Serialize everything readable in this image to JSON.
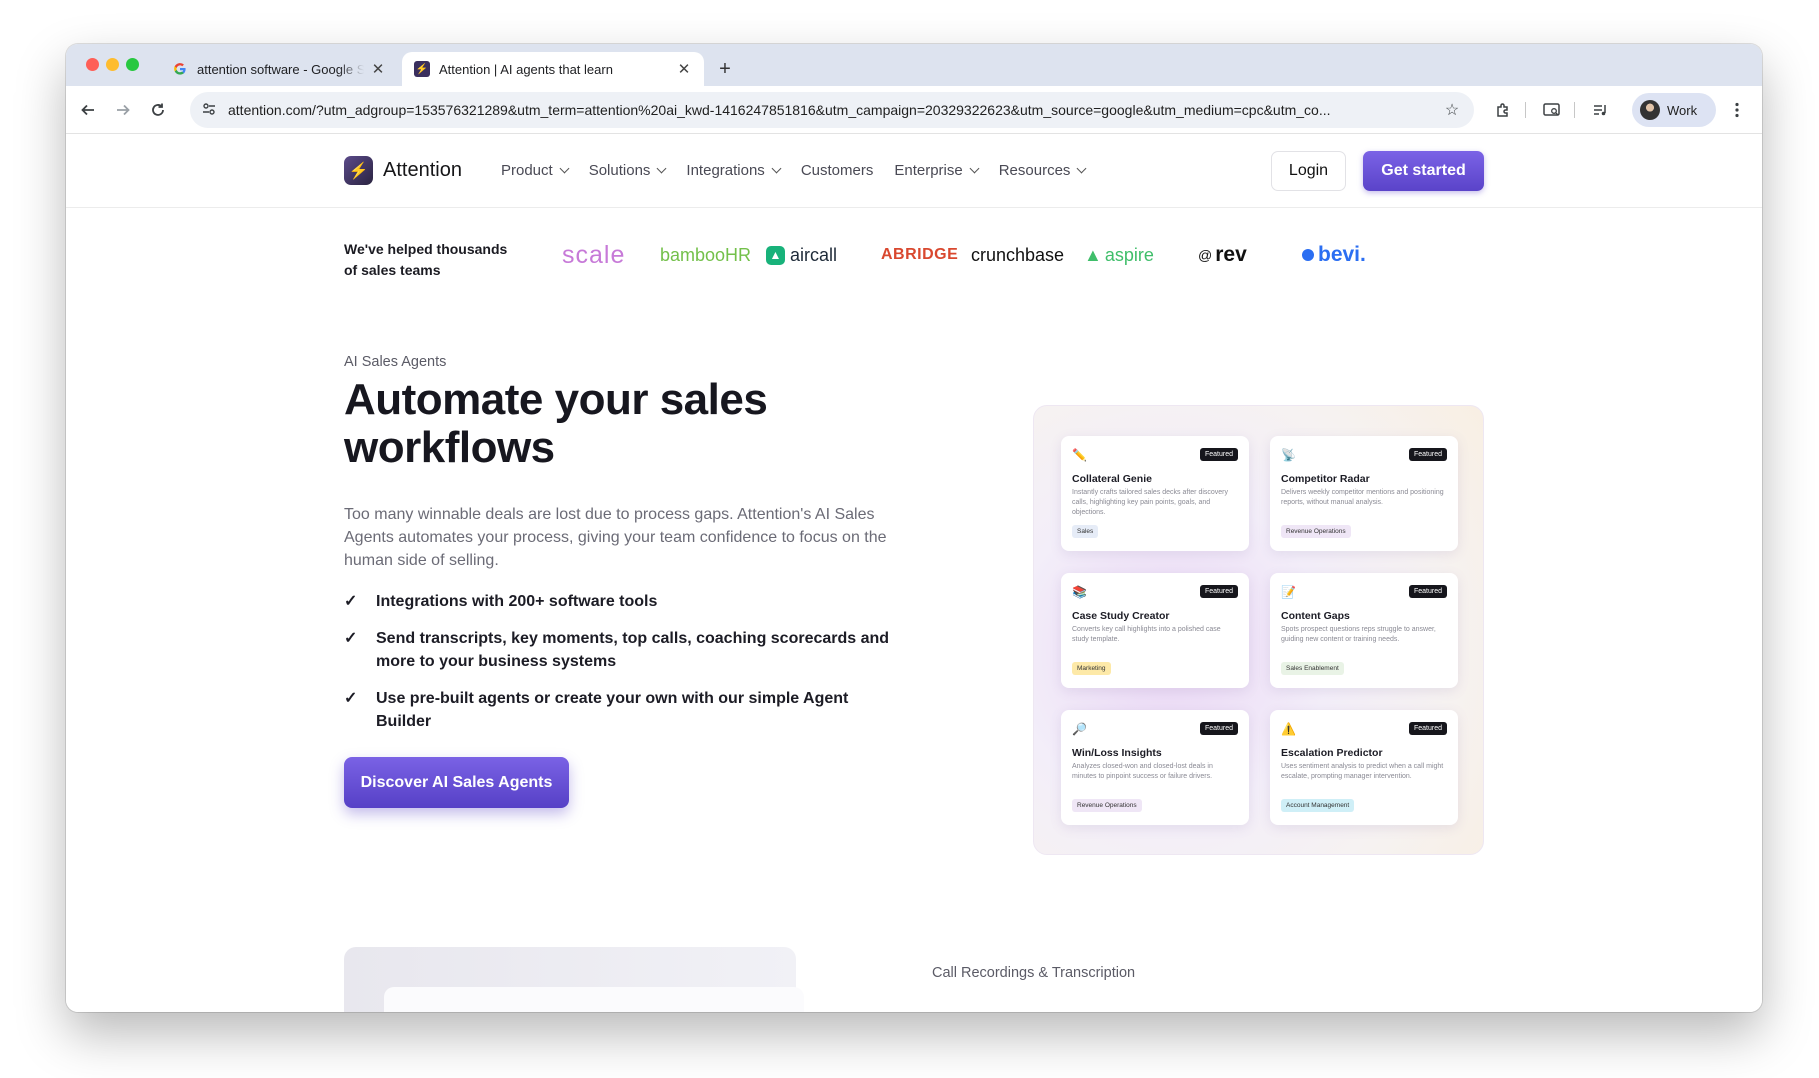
{
  "browser": {
    "tabs": [
      {
        "title": "attention software - Google Search",
        "favicon": "google-g-icon",
        "active": false
      },
      {
        "title": "Attention | AI agents that learn",
        "favicon": "attention-logo-icon",
        "active": true
      }
    ],
    "new_tab_glyph": "+",
    "close_glyph": "✕",
    "url": "attention.com/?utm_adgroup=153576321289&utm_term=attention%20ai_kwd-1416247851816&utm_campaign=20329322623&utm_source=google&utm_medium=cpc&utm_co...",
    "profile_name": "Work"
  },
  "site": {
    "brand": "Attention",
    "nav": [
      {
        "label": "Product",
        "dropdown": true
      },
      {
        "label": "Solutions",
        "dropdown": true
      },
      {
        "label": "Integrations",
        "dropdown": true
      },
      {
        "label": "Customers",
        "dropdown": false
      },
      {
        "label": "Enterprise",
        "dropdown": true
      },
      {
        "label": "Resources",
        "dropdown": true
      }
    ],
    "login": "Login",
    "get_started": "Get started",
    "accent": "#6a52d8"
  },
  "social_proof": {
    "text": "We've helped thousands of sales teams",
    "logos": [
      "scale",
      "bambooHR",
      "aircall",
      "ABRIDGE",
      "crunchbase",
      "aspire",
      "rev",
      "bevi."
    ]
  },
  "hero": {
    "eyebrow": "AI Sales Agents",
    "headline": "Automate your sales workflows",
    "description": "Too many winnable deals are lost due to process gaps. Attention's AI Sales Agents automates your process, giving your team confidence to focus on the human side of selling.",
    "check_glyph": "✓",
    "features": [
      "Integrations with 200+ software tools",
      "Send transcripts, key moments, top calls, coaching scorecards and more to your business systems",
      "Use pre-built agents or create your own with our simple Agent Builder"
    ],
    "cta": "Discover AI Sales Agents"
  },
  "agents": [
    {
      "icon": "pen-icon",
      "glyph": "✏️",
      "badge": "Featured",
      "title": "Collateral Genie",
      "desc": "Instantly crafts tailored sales decks after discovery calls, highlighting key pain points, goals, and objections.",
      "tag": "Sales",
      "tag_color": "#e6ecf7"
    },
    {
      "icon": "satellite-icon",
      "glyph": "📡",
      "badge": "Featured",
      "title": "Competitor Radar",
      "desc": "Delivers weekly competitor mentions and positioning reports, without manual analysis.",
      "tag": "Revenue Operations",
      "tag_color": "#efe6f6"
    },
    {
      "icon": "books-icon",
      "glyph": "📚",
      "badge": "Featured",
      "title": "Case Study Creator",
      "desc": "Converts key call highlights into a polished case study template.",
      "tag": "Marketing",
      "tag_color": "#fde9a8"
    },
    {
      "icon": "memo-icon",
      "glyph": "📝",
      "badge": "Featured",
      "title": "Content Gaps",
      "desc": "Spots prospect questions reps struggle to answer, guiding new content or training needs.",
      "tag": "Sales Enablement",
      "tag_color": "#e9f3e6"
    },
    {
      "icon": "magnifier-icon",
      "glyph": "🔎",
      "badge": "Featured",
      "title": "Win/Loss Insights",
      "desc": "Analyzes closed-won and closed-lost deals in minutes to pinpoint success or failure drivers.",
      "tag": "Revenue Operations",
      "tag_color": "#efe6f6"
    },
    {
      "icon": "warning-icon",
      "glyph": "⚠️",
      "badge": "Featured",
      "title": "Escalation Predictor",
      "desc": "Uses sentiment analysis to predict when a call might escalate, prompting manager intervention.",
      "tag": "Account Management",
      "tag_color": "#cfeff7"
    }
  ],
  "next_section": {
    "label": "Call Recordings & Transcription"
  }
}
